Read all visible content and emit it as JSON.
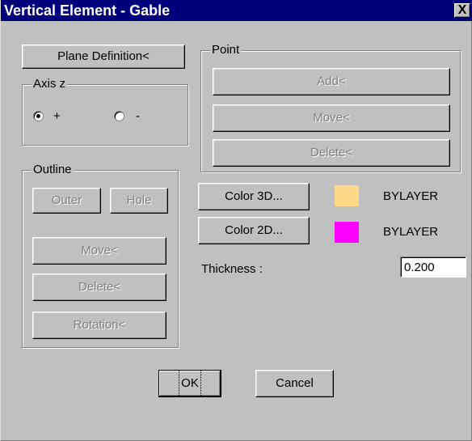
{
  "window": {
    "title": "Vertical Element - Gable",
    "close_label": "X"
  },
  "plane_definition_button": "Plane Definition<",
  "axis_z": {
    "label": "Axis z",
    "options": [
      {
        "label": "+",
        "selected": true
      },
      {
        "label": "-",
        "selected": false
      }
    ]
  },
  "outline": {
    "label": "Outline",
    "outer_label": "Outer",
    "hole_label": "Hole",
    "move_label": "Move<",
    "delete_label": "Delete<",
    "rotation_label": "Rotation<"
  },
  "point": {
    "label": "Point",
    "add_label": "Add<",
    "move_label": "Move<",
    "delete_label": "Delete<"
  },
  "color3d": {
    "button_label": "Color 3D...",
    "value": "BYLAYER",
    "color": "#ffd98a"
  },
  "color2d": {
    "button_label": "Color 2D...",
    "value": "BYLAYER",
    "color": "#ff00ff"
  },
  "thickness": {
    "label": "Thickness :",
    "value": "0.200"
  },
  "ok_label": "OK",
  "cancel_label": "Cancel"
}
